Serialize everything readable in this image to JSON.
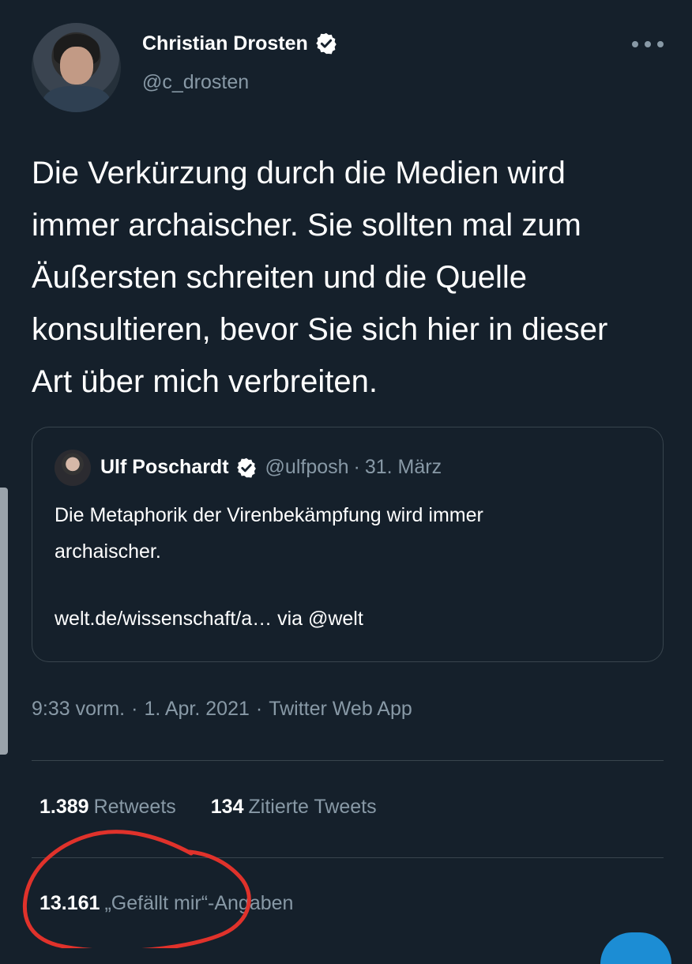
{
  "author": {
    "display_name": "Christian Drosten",
    "handle": "@c_drosten"
  },
  "tweet": {
    "text": "Die Verkürzung durch die Medien wird\nimmer archaischer. Sie sollten mal zum\nÄußersten schreiten und die Quelle\nkonsultieren, bevor Sie sich hier in dieser\nArt über mich verbreiten."
  },
  "quoted": {
    "display_name": "Ulf Poschardt",
    "handle": "@ulfposh",
    "separator": "·",
    "date": "31. März",
    "text": "Die Metaphorik der Virenbekämpfung wird immer\narchaischer.",
    "link": "welt.de/wissenschaft/a… via @welt"
  },
  "meta": {
    "time": "9:33 vorm.",
    "date": "1. Apr. 2021",
    "source": "Twitter Web App",
    "separator": "·"
  },
  "stats": {
    "retweets_count": "1.389",
    "retweets_label": "Retweets",
    "quotes_count": "134",
    "quotes_label": "Zitierte Tweets",
    "likes_count": "13.161",
    "likes_label": "„Gefällt mir“-Angaben"
  },
  "colors": {
    "background": "#15202b",
    "secondary_text": "#8899a6",
    "border": "#38444d",
    "annotation": "#e0322b"
  }
}
